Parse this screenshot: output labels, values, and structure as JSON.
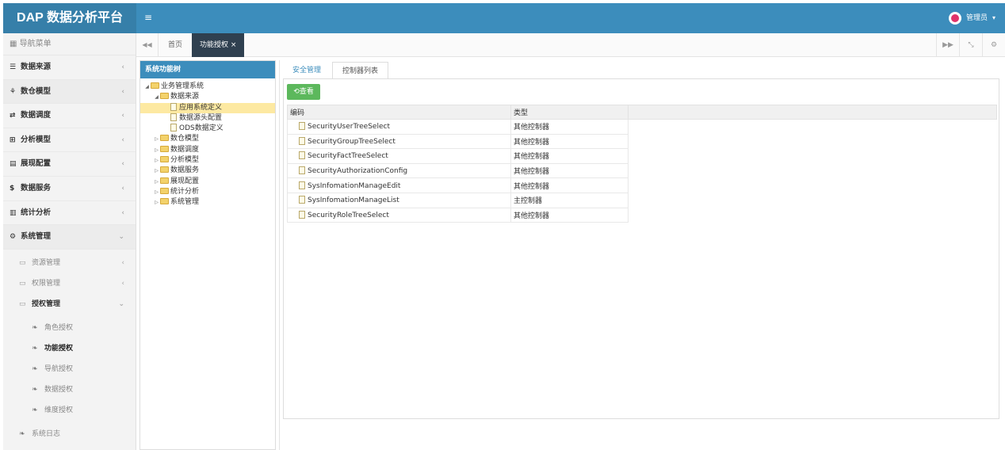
{
  "header": {
    "title": "DAP 数据分析平台",
    "menu_toggle": "≡",
    "user_name": "管理员",
    "caret": "▾",
    "accent": "#3c8dbc"
  },
  "sidebar": {
    "title": "导航菜单",
    "items": [
      {
        "label": "数据来源",
        "icon": "database-icon",
        "chevron": "‹"
      },
      {
        "label": "数仓模型",
        "icon": "cubes-icon",
        "chevron": "‹"
      },
      {
        "label": "数据调度",
        "icon": "shuffle-icon",
        "chevron": "‹"
      },
      {
        "label": "分析模型",
        "icon": "sitemap-icon",
        "chevron": "‹"
      },
      {
        "label": "展现配置",
        "icon": "film-icon",
        "chevron": "‹"
      },
      {
        "label": "数据服务",
        "icon": "dollar-icon",
        "chevron": "‹"
      },
      {
        "label": "统计分析",
        "icon": "bar-chart-icon",
        "chevron": "‹"
      },
      {
        "label": "系统管理",
        "icon": "gear-icon",
        "chevron": "›"
      }
    ],
    "sub_items": [
      {
        "label": "资源管理",
        "chevron": "‹"
      },
      {
        "label": "权限管理",
        "chevron": "‹"
      },
      {
        "label": "授权管理",
        "chevron": "⌄"
      }
    ],
    "leaves": [
      "角色授权",
      "功能授权",
      "导航授权",
      "数据授权",
      "维度授权"
    ],
    "log": "系统日志"
  },
  "tabbar": {
    "home": "首页",
    "active_tab": "功能授权",
    "close": "×"
  },
  "tree": {
    "title": "系统功能树",
    "root": "业务管理系统",
    "level1_open": "数据来源",
    "leaves": [
      "应用系统定义",
      "数据源头配置",
      "ODS数据定义"
    ],
    "siblings": [
      "数仓模型",
      "数据调度",
      "分析模型",
      "数据服务",
      "展现配置",
      "统计分析",
      "系统管理"
    ]
  },
  "content": {
    "tabs": [
      "安全管理",
      "控制器列表"
    ],
    "view_button": "查看",
    "columns": [
      "编码",
      "类型"
    ],
    "rows": [
      {
        "code": "SecurityUserTreeSelect",
        "type": "其他控制器"
      },
      {
        "code": "SecurityGroupTreeSelect",
        "type": "其他控制器"
      },
      {
        "code": "SecurityFactTreeSelect",
        "type": "其他控制器"
      },
      {
        "code": "SecurityAuthorizationConfig",
        "type": "其他控制器"
      },
      {
        "code": "SysInfomationManageEdit",
        "type": "其他控制器"
      },
      {
        "code": "SysInfomationManageList",
        "type": "主控制器"
      },
      {
        "code": "SecurityRoleTreeSelect",
        "type": "其他控制器"
      }
    ]
  }
}
